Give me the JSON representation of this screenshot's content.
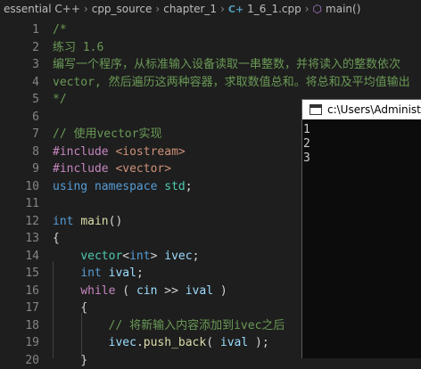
{
  "breadcrumb": {
    "items": [
      "essential C++",
      "cpp_source",
      "chapter_1",
      "1_6_1.cpp",
      "main()"
    ],
    "file_icon": "C+",
    "func_icon": "cube-icon"
  },
  "editor": {
    "lines": [
      {
        "n": "1",
        "t": [
          [
            "/*",
            "cm"
          ]
        ]
      },
      {
        "n": "2",
        "t": [
          [
            "练习 1.6",
            "cm"
          ]
        ]
      },
      {
        "n": "3",
        "t": [
          [
            "编写一个程序，从标准输入设备读取一串整数，并将读入的整数依次",
            "cm"
          ]
        ]
      },
      {
        "n": "4",
        "t": [
          [
            "vector, 然后遍历这两种容器，求取数值总和。将总和及平均值输出",
            "cm"
          ]
        ]
      },
      {
        "n": "5",
        "t": [
          [
            "*/",
            "cm"
          ]
        ]
      },
      {
        "n": "6",
        "t": []
      },
      {
        "n": "7",
        "t": [
          [
            "// 使用vector实现",
            "cm"
          ]
        ]
      },
      {
        "n": "8",
        "t": [
          [
            "#include ",
            "pp"
          ],
          [
            "<iostream>",
            "inc"
          ]
        ]
      },
      {
        "n": "9",
        "t": [
          [
            "#include ",
            "pp"
          ],
          [
            "<vector>",
            "inc"
          ]
        ]
      },
      {
        "n": "10",
        "t": [
          [
            "using ",
            "kw"
          ],
          [
            "namespace ",
            "kw"
          ],
          [
            "std",
            "ty"
          ],
          [
            ";",
            "pl"
          ]
        ]
      },
      {
        "n": "11",
        "t": []
      },
      {
        "n": "12",
        "t": [
          [
            "int ",
            "kw"
          ],
          [
            "main",
            "fn"
          ],
          [
            "()",
            "pl"
          ]
        ]
      },
      {
        "n": "13",
        "t": [
          [
            "{",
            "pl"
          ]
        ]
      },
      {
        "n": "14",
        "t": [
          [
            "    ",
            "pl"
          ],
          [
            "vector",
            "ty"
          ],
          [
            "<",
            "pl"
          ],
          [
            "int",
            "kw"
          ],
          [
            "> ",
            "pl"
          ],
          [
            "ivec",
            "var"
          ],
          [
            ";",
            "pl"
          ]
        ]
      },
      {
        "n": "15",
        "t": [
          [
            "    ",
            "pl"
          ],
          [
            "int ",
            "kw"
          ],
          [
            "ival",
            "var"
          ],
          [
            ";",
            "pl"
          ]
        ]
      },
      {
        "n": "16",
        "t": [
          [
            "    ",
            "pl"
          ],
          [
            "while ",
            "pp"
          ],
          [
            "( ",
            "pl"
          ],
          [
            "cin ",
            "var"
          ],
          [
            ">> ",
            "pl"
          ],
          [
            "ival ",
            "var"
          ],
          [
            ")",
            "pl"
          ]
        ]
      },
      {
        "n": "17",
        "t": [
          [
            "    ",
            "pl"
          ],
          [
            "{",
            "pl"
          ]
        ]
      },
      {
        "n": "18",
        "t": [
          [
            "        ",
            "pl"
          ],
          [
            "// 将新输入内容添加到ivec之后",
            "cm"
          ]
        ]
      },
      {
        "n": "19",
        "t": [
          [
            "        ",
            "pl"
          ],
          [
            "ivec",
            "var"
          ],
          [
            ".",
            "pl"
          ],
          [
            "push_back",
            "fn"
          ],
          [
            "( ",
            "pl"
          ],
          [
            "ival ",
            "var"
          ],
          [
            ");",
            "pl"
          ]
        ]
      },
      {
        "n": "20",
        "t": [
          [
            "    ",
            "pl"
          ],
          [
            "}",
            "pl"
          ]
        ]
      }
    ]
  },
  "console": {
    "title": "c:\\Users\\Administrator",
    "output": [
      "1",
      "2",
      "3"
    ]
  }
}
